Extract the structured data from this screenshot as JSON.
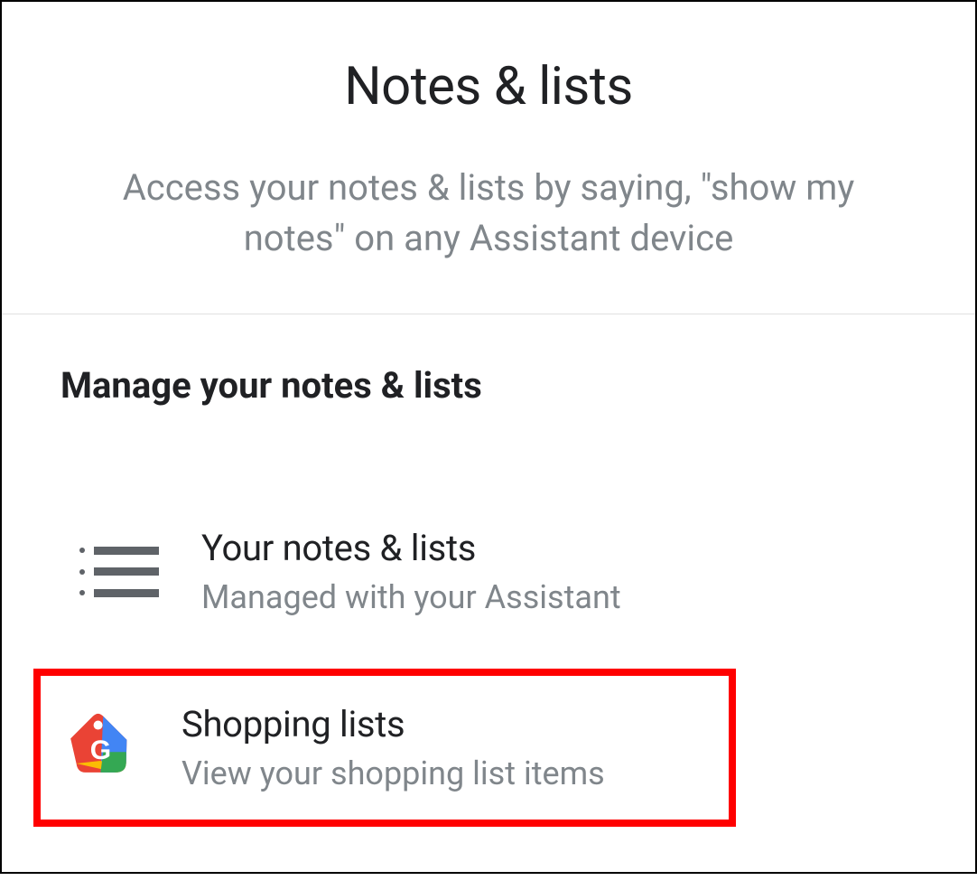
{
  "header": {
    "title": "Notes & lists",
    "subtitle": "Access your notes & lists by saying, \"show my notes\" on any Assistant device"
  },
  "section": {
    "heading": "Manage your notes & lists",
    "items": [
      {
        "title": "Your notes & lists",
        "subtitle": "Managed with your Assistant"
      },
      {
        "title": "Shopping lists",
        "subtitle": "View your shopping list items"
      }
    ]
  }
}
